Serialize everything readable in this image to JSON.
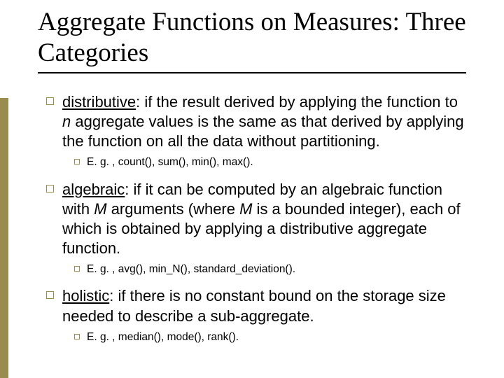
{
  "title": "Aggregate Functions on Measures: Three Categories",
  "items": [
    {
      "term": "distributive",
      "colon": ": ",
      "body_before_em": "if the result derived by applying the function to ",
      "em": "n",
      "body_after_em": " aggregate values is the same as that derived by applying the function on all the data without partitioning.",
      "example": "E. g. , count(), sum(), min(), max()."
    },
    {
      "term": "algebraic",
      "colon": ": ",
      "body_before_em": "if it can be computed by an algebraic function with ",
      "em": "M",
      "body_after_em_1": " arguments (where ",
      "em2": "M",
      "body_after_em_2": " is a bounded integer), each of which is obtained by applying a distributive aggregate function.",
      "example": "E. g. ,  avg(), min_N(), standard_deviation()."
    },
    {
      "term": "holistic",
      "colon": ": ",
      "body": "if there is no constant bound on the storage size needed to describe a sub-aggregate.",
      "example": "E. g. , median(), mode(), rank()."
    }
  ]
}
